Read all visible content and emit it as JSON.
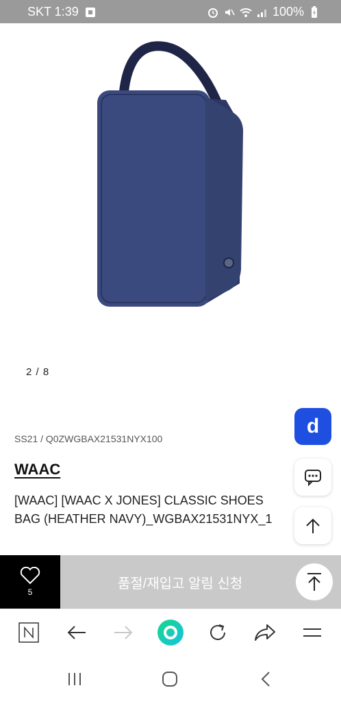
{
  "status_bar": {
    "carrier_time": "SKT 1:39",
    "battery": "100%"
  },
  "product": {
    "image_desc_icon": "shoe-bag-image",
    "pager": "2 / 8",
    "season_code": "SS21 / Q0ZWGBAX21531NYX100",
    "brand": "WAAC",
    "title": "[WAAC] [WAAC X JONES] CLASSIC SHOES BAG (HEATHER NAVY)_WGBAX21531NYX_1"
  },
  "floating": {
    "d_label": "d"
  },
  "action_bar": {
    "like_count": "5",
    "restock_label": "품절/재입고 알림 신청"
  },
  "colors": {
    "accent_blue": "#1f4fe0",
    "bag_navy": "#3b4a7e",
    "restock_bg": "#c9c9c9",
    "naver_green": "#19d68a"
  }
}
